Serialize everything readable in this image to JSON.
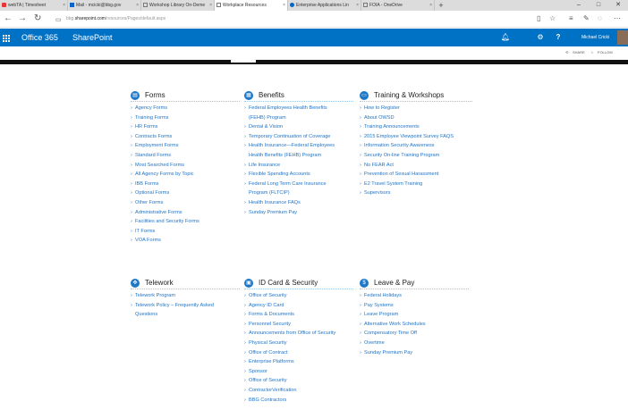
{
  "browser": {
    "tabs": [
      {
        "label": "webTA | Timesheet",
        "active": false
      },
      {
        "label": "Mail - mcicki@bbg.gov",
        "active": false
      },
      {
        "label": "Workshop Library On-Deme",
        "active": false
      },
      {
        "label": "Workplace Resources",
        "active": true
      },
      {
        "label": "Enterprise Applications Lin",
        "active": false
      },
      {
        "label": "FOIA - OneDrive",
        "active": false
      }
    ],
    "url_prefix": "bbg.",
    "url_host": "sharepoint.com",
    "url_path": "/resources/Pages/default.aspx"
  },
  "suite": {
    "brand": "Office 365",
    "app": "SharePoint",
    "user_name": "Michael Cricki"
  },
  "page_actions": {
    "share": "SHARE",
    "follow": "FOLLOW"
  },
  "sections": {
    "forms": {
      "title": "Forms",
      "links": [
        "Agency Forms",
        "Training Forms",
        "HR Forms",
        "Contracts Forms",
        "Employment Forms",
        "Standard Forms",
        "Most Searched Forms",
        "All Agency Forms by Topic",
        "IBB Forms",
        "Optional Forms",
        "Other Forms",
        "Administrative Forms",
        "Facilities and Security Forms",
        "IT Forms",
        "VOA Forms"
      ]
    },
    "benefits": {
      "title": "Benefits",
      "links": [
        [
          "Federal Employees Health Benefits",
          "(FEHB) Program"
        ],
        [
          "Dental & Vision"
        ],
        [
          "Temporary Continuation of Coverage"
        ],
        [
          "Health Insurance—Federal Employees",
          "Health Benefits (FEHB) Program"
        ],
        [
          "Life Insurance"
        ],
        [
          "Flexible Spending Accounts"
        ],
        [
          "Federal Long Term Care Insurance",
          "Program (FLTCIP)"
        ],
        [
          "Health Insurance FAQs"
        ],
        [
          "Sunday Premium Pay"
        ]
      ]
    },
    "training": {
      "title": "Training & Workshops",
      "links": [
        "How to Register",
        "About OWSD",
        "Training Announcements",
        "2015 Employee Viewpoint Survey FAQS",
        "Information Security Awareness",
        "Security On-line Training Program",
        "No FEAR Act",
        "Prevention of Sexual Harassment",
        "E2 Travel System Training",
        "Supervisors"
      ]
    },
    "telework": {
      "title": "Telework",
      "links": [
        [
          "Telework Program"
        ],
        [
          "Telework Policy – Frequently Asked",
          "Questions"
        ]
      ]
    },
    "idcard": {
      "title": "ID Card & Security",
      "links": [
        "Office of Security",
        "Agency ID Card",
        "Forms & Documents",
        "Personnel Security",
        "Announcements from Office of Security",
        "Physical Security",
        "Office of Contract",
        "Enterprise Platforms",
        "Sponsor",
        "Office of Security",
        "ContractorVerification",
        "BBG Contractors"
      ]
    },
    "leave": {
      "title": "Leave & Pay",
      "links": [
        "Federal Holidays",
        "Pay Systems",
        "Leave Program",
        "Alternative Work Schedules",
        "Compensatory Time Off",
        "Overtime",
        "Sunday Premium Pay"
      ]
    }
  },
  "colors": {
    "suite_bar": "#0072c6",
    "link": "#1e74c8",
    "section_icon": "#1e78c8"
  },
  "icons": [
    "waffle-icon",
    "bell-icon",
    "gear-icon",
    "help-icon",
    "forms-icon",
    "benefits-icon",
    "training-icon",
    "telework-icon",
    "idcard-icon",
    "dollar-icon"
  ]
}
